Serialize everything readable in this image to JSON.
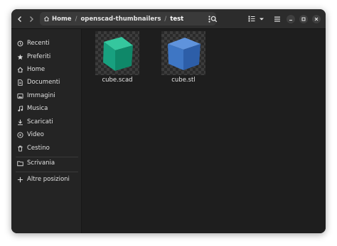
{
  "breadcrumb": {
    "home_label": "Home",
    "separator": "/",
    "folder_label": "openscad-thumbnailers",
    "current_label": "test"
  },
  "sidebar": {
    "items": [
      {
        "label": "Recenti",
        "icon": "clock-icon"
      },
      {
        "label": "Preferiti",
        "icon": "star-icon"
      },
      {
        "label": "Home",
        "icon": "home-icon"
      },
      {
        "label": "Documenti",
        "icon": "document-icon"
      },
      {
        "label": "Immagini",
        "icon": "image-icon"
      },
      {
        "label": "Musica",
        "icon": "music-icon"
      },
      {
        "label": "Scaricati",
        "icon": "download-icon"
      },
      {
        "label": "Video",
        "icon": "video-icon"
      },
      {
        "label": "Cestino",
        "icon": "trash-icon"
      }
    ],
    "desktop": {
      "label": "Scrivania",
      "icon": "folder-icon"
    },
    "other": {
      "label": "Altre posizioni",
      "icon": "plus-icon"
    }
  },
  "files": [
    {
      "name": "cube.scad",
      "color": "#1fa381"
    },
    {
      "name": "cube.stl",
      "color": "#3f78c4"
    }
  ],
  "colors": {
    "window_bg": "#1e1e1e",
    "headerbar_bg": "#2c2c2c",
    "sidebar_bg": "#242424"
  }
}
